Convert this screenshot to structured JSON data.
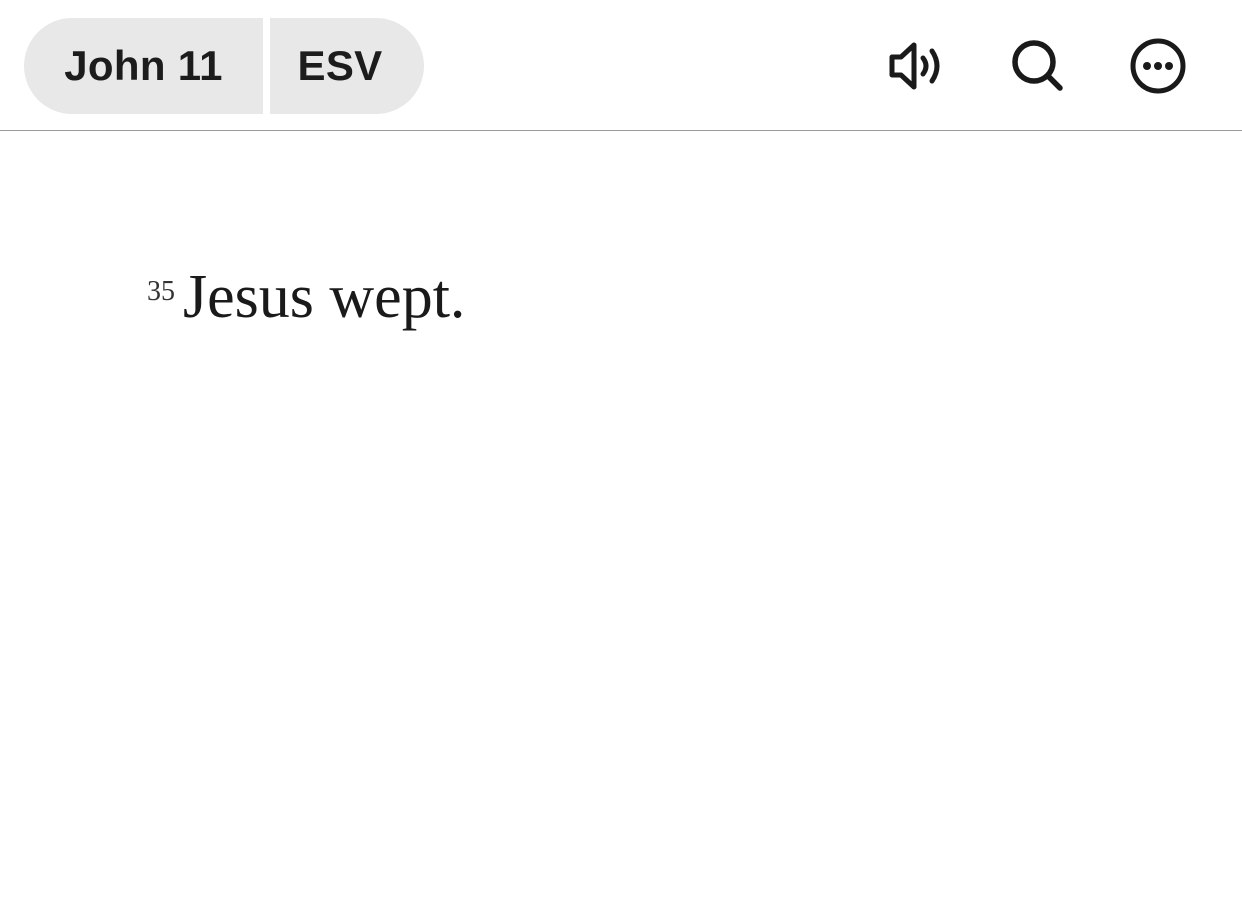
{
  "header": {
    "book_chapter": "John 11",
    "version": "ESV"
  },
  "toolbar": {
    "audio_icon": "speaker-wave-icon",
    "search_icon": "search-icon",
    "more_icon": "more-ellipsis-icon"
  },
  "content": {
    "verse_number": "35",
    "verse_text": "Jesus wept."
  },
  "colors": {
    "pill_background": "#e8e8e8",
    "text": "#1a1a1a",
    "divider": "#9a9a9a",
    "background": "#ffffff"
  }
}
